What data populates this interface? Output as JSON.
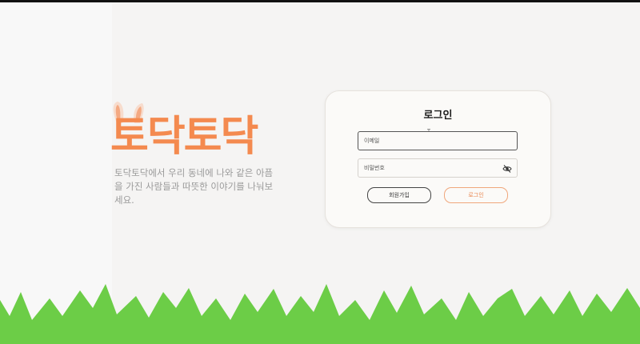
{
  "brand": {
    "logo": "토닥토닥",
    "tagline": "토닥토닥에서 우리 동네에 나와 같은 아픔을 가진 사람들과 따뜻한 이야기를 나눠보세요."
  },
  "login": {
    "title": "로그인",
    "email_placeholder": "이메일",
    "password_placeholder": "비밀번호",
    "signup_label": "회원가입",
    "login_label": "로그인"
  },
  "icons": {
    "password_toggle": "eye-off-icon",
    "ears": "bunny-ears-icon",
    "cursor": "text-cursor-icon"
  },
  "colors": {
    "accent": "#f48a4f",
    "grass": "#6ccd47",
    "background": "#f5f4f3"
  }
}
